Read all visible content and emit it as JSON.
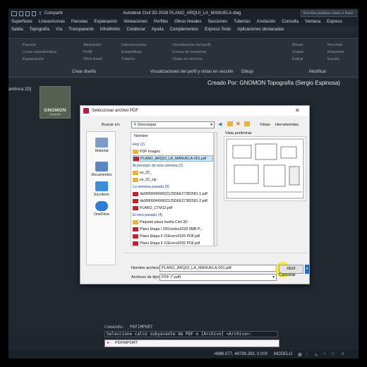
{
  "titlebar": {
    "share_label": "Compartir",
    "title": "Autodesk Civil 3D 2026  PLANO_ARQUI_LA_MANUELA.dwg",
    "search_placeholder": "Escriba palabra clave o frase"
  },
  "menu_row1": [
    "Superficies",
    "Líneas/curvas",
    "Parcelas",
    "Explanación",
    "Alineaciones",
    "Perfiles",
    "Obras lineales",
    "Secciones",
    "Tuberías",
    "Anotación",
    "Consulta",
    "Ventana",
    "Express"
  ],
  "menu_row2": [
    "Salida",
    "Topografía",
    "Vía",
    "Transparente",
    "InfraWorks",
    "Colaborar",
    "Ayuda",
    "Complementos",
    "Express Tools",
    "Aplicaciones destacadas"
  ],
  "ribbon": {
    "items": [
      "Parcela",
      "Línea característica",
      "Explanación",
      "Alineación",
      "Perfil",
      "Obra lineal",
      "Intersecciones",
      "Ensamblaje",
      "Tubería",
      "Visualización del perfil",
      "Líneas de muestreo",
      "Vistas en sección",
      "Mover",
      "Copiar",
      "Estirar",
      "Recortar",
      "Empalme",
      "Escala"
    ],
    "panel_crear": "Crear diseño",
    "panel_perfil": "Visualizaciones del perfil y vistas en sección",
    "panel_dibujo": "Dibujo",
    "panel_modificar": "Modificar"
  },
  "drawing": {
    "credit": "Creado Por: GNOMON Topografía (Sergio Espinosa)",
    "view_label": "ámbrica 2D]",
    "logo_title": "GNOMON",
    "logo_subtitle": "Topografía"
  },
  "dialog": {
    "title": "Seleccionar archivo PDF",
    "search_in_label": "Buscar en:",
    "search_in_value": "Descargas",
    "views_label": "Vistas",
    "tools_label": "Herramientas",
    "column_header": "Nombre",
    "preview_label": "Vista preliminar",
    "places": [
      "Historial",
      "Documentos",
      "Escritorio",
      "OneDrive"
    ],
    "files": [
      {
        "kind": "group",
        "text": "Hoy (2)"
      },
      {
        "kind": "folder",
        "text": "PDF Images"
      },
      {
        "kind": "pdf",
        "text": "PLANO_ARQUI_LA_MANUELA-001.pdf",
        "selected": true
      },
      {
        "kind": "group",
        "text": "Al principio de esta semana (2)"
      },
      {
        "kind": "folder",
        "text": "es_02_"
      },
      {
        "kind": "folder",
        "text": "es_02_zip"
      },
      {
        "kind": "group",
        "text": "La semana pasada (3)"
      },
      {
        "kind": "pdf",
        "text": "ds089090499602125DEE27382581-1.pdf"
      },
      {
        "kind": "pdf",
        "text": "ds089090499602125DEE27382581-2.pdf"
      },
      {
        "kind": "pdf",
        "text": "PLANO_CTM12.pdf"
      },
      {
        "kind": "group",
        "text": "El mes pasado (4)"
      },
      {
        "kind": "folder",
        "text": "Paquete placa huella Civil 3D"
      },
      {
        "kind": "pdf",
        "text": "Plano Etapa I 20Octubre2025 9MB P..."
      },
      {
        "kind": "pdf",
        "text": "Plano Etapa II 21Enero2026 PDF.pdf"
      },
      {
        "kind": "pdf",
        "text": "Plano Etapa II 21Enero2026 PDF.pdf"
      }
    ],
    "filename_label": "Nombre archivo:",
    "filename_value": "PLANO_ARQUI_LA_MANUELA-001.pdf",
    "filetype_label": "Archivos de tipo:",
    "filetype_value": "PDF (*.pdf)",
    "open_label": "Abrir",
    "cancel_label": "Cancelar"
  },
  "command": {
    "line1": "Comando: _PDFIMPORT",
    "line2": "Seleccione calco subyacente de PDF o [Archivo] <Archivo>:",
    "input": "PDFIMPORT"
  },
  "status": {
    "coords": "-4986.077, 48799.283, 0.000",
    "model_label": "MODELO"
  }
}
